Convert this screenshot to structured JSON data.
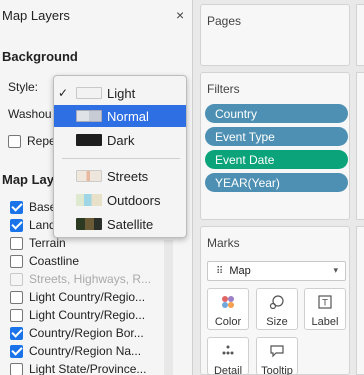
{
  "panel": {
    "title": "Map Layers",
    "close_symbol": "×"
  },
  "background": {
    "heading": "Background",
    "style_label": "Style:",
    "washout_label": "Washou",
    "repeat_label": "Repe"
  },
  "style_dropdown": {
    "checkmark": "✓",
    "items": [
      {
        "label": "Light",
        "checked": true,
        "selected": false,
        "swatch": "light"
      },
      {
        "label": "Normal",
        "checked": false,
        "selected": true,
        "swatch": "normal"
      },
      {
        "label": "Dark",
        "checked": false,
        "selected": false,
        "swatch": "dark"
      },
      {
        "label": "Streets",
        "swatch": "streets"
      },
      {
        "label": "Outdoors",
        "swatch": "outdoors"
      },
      {
        "label": "Satellite",
        "swatch": "satellite"
      }
    ]
  },
  "layers": {
    "heading": "Map Laye",
    "items": [
      {
        "label": "Base",
        "checked": true
      },
      {
        "label": "Land",
        "checked": true
      },
      {
        "label": "Terrain",
        "checked": false
      },
      {
        "label": "Coastline",
        "checked": false
      },
      {
        "label": "Streets, Highways, R...",
        "checked": false,
        "disabled": true
      },
      {
        "label": "Light Country/Regio...",
        "checked": false
      },
      {
        "label": "Light Country/Regio...",
        "checked": false
      },
      {
        "label": "Country/Region Bor...",
        "checked": true
      },
      {
        "label": "Country/Region Na...",
        "checked": true
      },
      {
        "label": "Light State/Province...",
        "checked": false
      }
    ]
  },
  "pages": {
    "title": "Pages"
  },
  "filters": {
    "title": "Filters",
    "pills": [
      {
        "label": "Country",
        "color": "#4e90b3"
      },
      {
        "label": "Event Type",
        "color": "#4e90b3"
      },
      {
        "label": "Event Date",
        "color": "#0aa37a"
      },
      {
        "label": "YEAR(Year)",
        "color": "#4e90b3"
      }
    ]
  },
  "marks": {
    "title": "Marks",
    "mark_type": "Map",
    "buttons": {
      "color": "Color",
      "size": "Size",
      "label": "Label",
      "detail": "Detail",
      "tooltip": "Tooltip"
    }
  },
  "colors": {
    "accent": "#2f6fe4",
    "checkbox": "#1a73e8"
  }
}
